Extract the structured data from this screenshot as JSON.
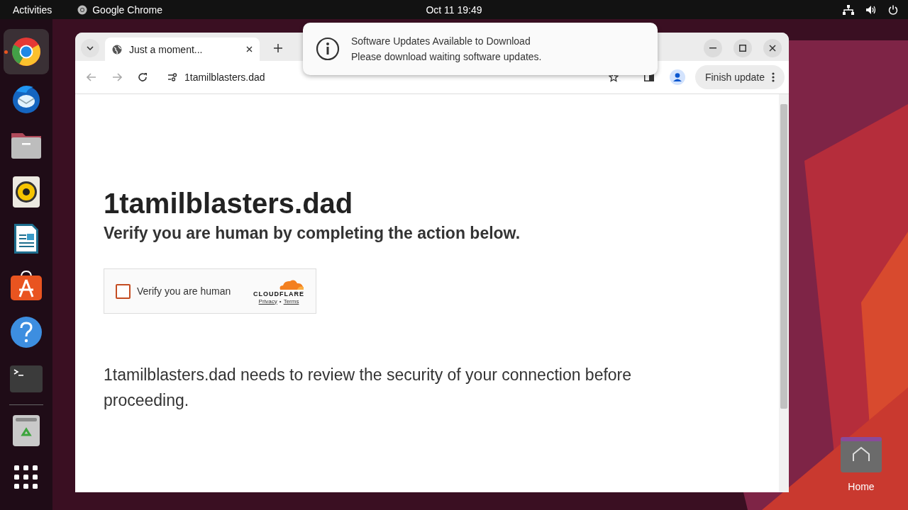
{
  "top_bar": {
    "activities": "Activities",
    "app_name": "Google Chrome",
    "clock": "Oct 11  19:49"
  },
  "dock": {
    "items": [
      {
        "kind": "chrome",
        "selected": true
      },
      {
        "kind": "mail",
        "selected": false
      },
      {
        "kind": "files",
        "selected": false
      },
      {
        "kind": "music",
        "selected": false
      },
      {
        "kind": "writer",
        "selected": false
      },
      {
        "kind": "store",
        "selected": false
      },
      {
        "kind": "help",
        "selected": false
      },
      {
        "kind": "terminal",
        "selected": false
      },
      {
        "kind": "trash",
        "selected": false
      },
      {
        "kind": "apps",
        "selected": false
      }
    ]
  },
  "browser": {
    "tab": {
      "title": "Just a moment...",
      "selected": true
    },
    "address": "1tamilblasters.dad",
    "finish_update": "Finish update"
  },
  "page": {
    "title": "1tamilblasters.dad",
    "subtitle": "Verify you are human by completing the action below.",
    "captcha": {
      "label": "Verify you are human",
      "checked": false,
      "brand": "CLOUDFLARE",
      "links": [
        "Privacy",
        "Terms"
      ],
      "link_separator": "•"
    },
    "message": "1tamilblasters.dad needs to review the security of your connection before proceeding."
  },
  "notification": {
    "title": "Software Updates Available to Download",
    "body": "Please download waiting software updates."
  },
  "desktop_icons": [
    {
      "label": "Home"
    }
  ]
}
